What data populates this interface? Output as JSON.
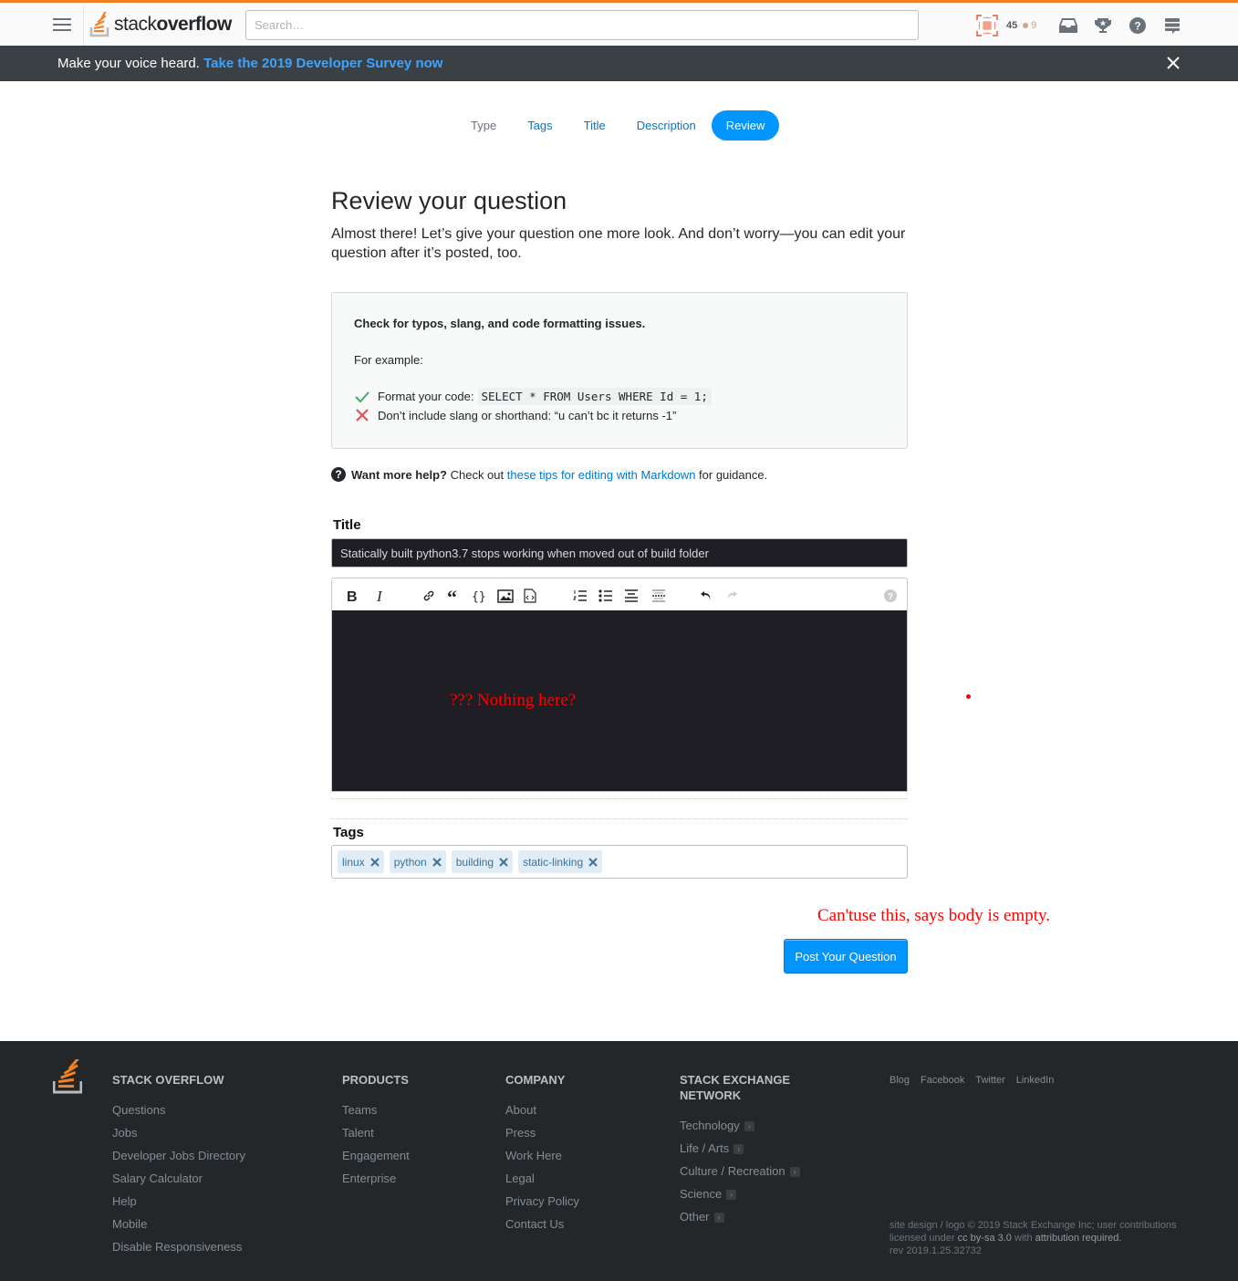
{
  "header": {
    "logo_text_light": "stack",
    "logo_text_bold": "overflow",
    "search_placeholder": "Search…",
    "reputation": "45",
    "bronze_badges": "9",
    "icons": [
      "hamburger-icon",
      "avatar-identicon",
      "inbox-icon",
      "achievements-icon",
      "help-icon",
      "site-switcher-icon"
    ]
  },
  "banner": {
    "text": "Make your voice heard.",
    "link": "Take the 2019 Developer Survey now"
  },
  "steps": [
    {
      "label": "Type",
      "state": "inactive"
    },
    {
      "label": "Tags",
      "state": "link"
    },
    {
      "label": "Title",
      "state": "link"
    },
    {
      "label": "Description",
      "state": "link"
    },
    {
      "label": "Review",
      "state": "active"
    }
  ],
  "main": {
    "title": "Review your question",
    "intro": "Almost there! Let’s give your question one more look. And don’t worry—you can edit your question after it’s posted, too.",
    "tips": {
      "heading": "Check for typos, slang, and code formatting issues.",
      "example_label": "For example:",
      "good_label": "Format your code:",
      "good_code": "SELECT * FROM Users WHERE Id = 1;",
      "bad_label": "Don’t include slang or shorthand: “u can’t bc it returns -1”"
    },
    "help": {
      "bold": "Want more help?",
      "pre": "Check out",
      "link": "these tips for editing with Markdown",
      "post": "for guidance."
    },
    "title_label": "Title",
    "title_value": "Statically built python3.7 stops working when moved out of build folder",
    "body_value": "",
    "tags_label": "Tags",
    "tags": [
      "linux",
      "python",
      "building",
      "static-linking"
    ],
    "post_button": "Post Your Question"
  },
  "annotations": {
    "editor_note": "??? Nothing here?",
    "button_note": "Can'tuse this, says body is empty."
  },
  "footer": {
    "columns": [
      {
        "heading": "Stack Overflow",
        "links": [
          "Questions",
          "Jobs",
          "Developer Jobs Directory",
          "Salary Calculator",
          "Help",
          "Mobile",
          "Disable Responsiveness"
        ]
      },
      {
        "heading": "Products",
        "links": [
          "Teams",
          "Talent",
          "Engagement",
          "Enterprise"
        ]
      },
      {
        "heading": "Company",
        "links": [
          "About",
          "Press",
          "Work Here",
          "Legal",
          "Privacy Policy",
          "Contact Us"
        ]
      },
      {
        "heading_line1": "Stack Exchange",
        "heading_line2": "Network",
        "links": [
          "Technology",
          "Life / Arts",
          "Culture / Recreation",
          "Science",
          "Other"
        ]
      }
    ],
    "social": [
      "Blog",
      "Facebook",
      "Twitter",
      "LinkedIn"
    ],
    "copyright_line1": "site design / logo © 2019 Stack Exchange Inc; user contributions",
    "copyright_line2_pre": "licensed under",
    "license_link": "cc by-sa 3.0",
    "copyright_line2_mid": "with",
    "attribution_link": "attribution required.",
    "revision": "rev 2019.1.25.32732"
  },
  "colors": {
    "brand_orange": "#f48024",
    "primary_blue": "#0095ff",
    "link_blue": "#0077cc",
    "annotation_red": "#ff0000"
  }
}
